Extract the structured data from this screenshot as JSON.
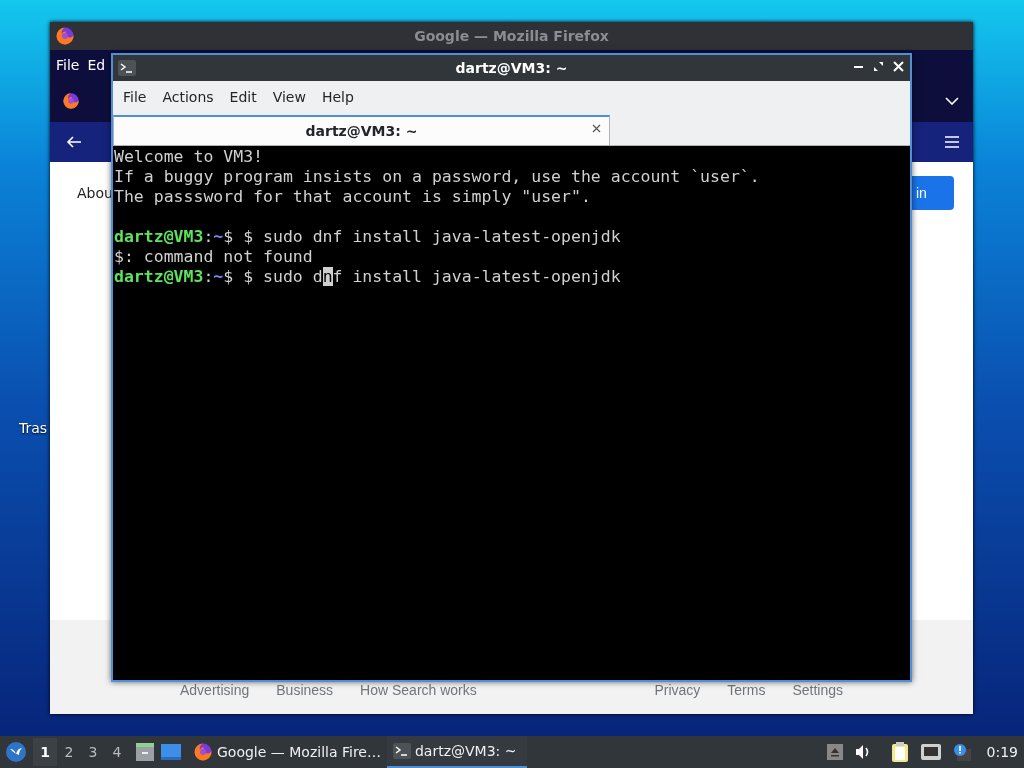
{
  "desktop": {
    "icons": [
      {
        "label": "Tras"
      }
    ]
  },
  "firefox": {
    "title": "Google — Mozilla Firefox",
    "menu": [
      "File",
      "Ed"
    ],
    "page": {
      "about_link": "Abou",
      "sign_in_button": "in",
      "footer_links": [
        "Advertising",
        "Business",
        "How Search works",
        "Privacy",
        "Terms",
        "Settings"
      ]
    }
  },
  "terminal": {
    "title": "dartz@VM3: ~",
    "menu": [
      "File",
      "Actions",
      "Edit",
      "View",
      "Help"
    ],
    "tabs": [
      {
        "label": "dartz@VM3: ~",
        "selected": true
      }
    ],
    "lines": [
      {
        "kind": "output",
        "text": "Welcome to VM3!"
      },
      {
        "kind": "output",
        "text": "If a buggy program insists on a password, use the account `user`."
      },
      {
        "kind": "output",
        "text": "The passsword for that account is simply \"user\"."
      },
      {
        "kind": "blank"
      },
      {
        "kind": "prompt",
        "user_host": "dartz@VM3",
        "separator": ":",
        "path": "~",
        "symbol": "$",
        "command": " $ sudo dnf install java-latest-openjdk"
      },
      {
        "kind": "output",
        "text": "$: command not found"
      },
      {
        "kind": "prompt",
        "user_host": "dartz@VM3",
        "separator": ":",
        "path": "~",
        "symbol": "$",
        "command": " $ sudo d",
        "cursor": "n",
        "command_rest": "f install java-latest-openjdk"
      }
    ]
  },
  "taskbar": {
    "desktops": [
      {
        "label": "1",
        "selected": true
      },
      {
        "label": "2",
        "selected": false
      },
      {
        "label": "3",
        "selected": false
      },
      {
        "label": "4",
        "selected": false
      }
    ],
    "tasks": [
      {
        "kind": "browser",
        "label": "Google — Mozilla Fire…",
        "selected": false
      },
      {
        "kind": "terminal",
        "label": "dartz@VM3: ~",
        "selected": true
      }
    ],
    "clock": "0:19"
  }
}
